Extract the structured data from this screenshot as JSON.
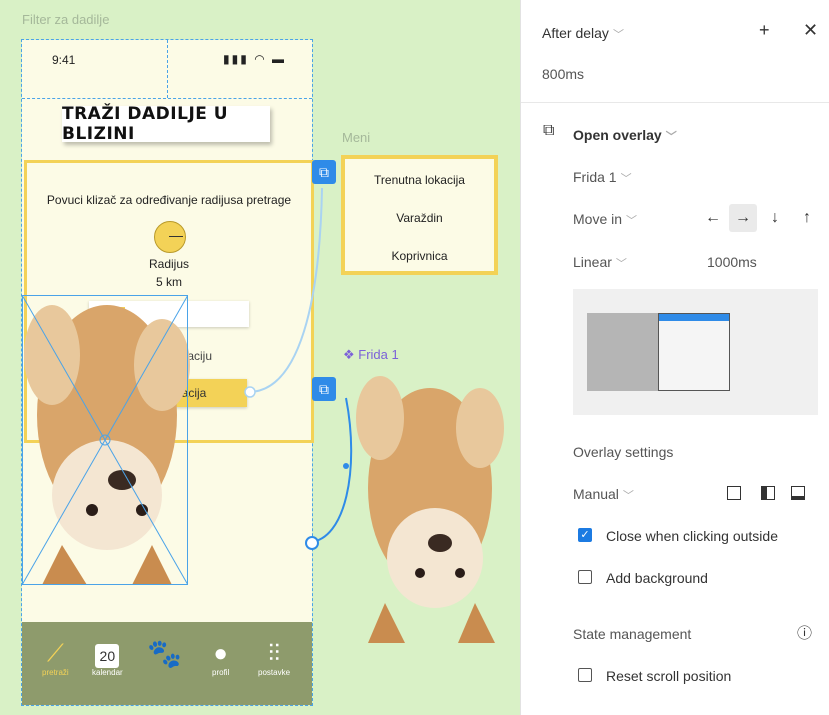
{
  "canvas": {
    "frame_label": "Filter za dadilje",
    "status_time": "9:41",
    "title": "TRAŽI DADILJE U BLIZINI",
    "hint": "Povuci klizač za određivanje radijusa pretrage",
    "radius_label": "Radijus",
    "radius_value": "5 km",
    "choose_location": "Odaberi lokaciju",
    "wanted_location": "Željena lokacija",
    "nav": [
      {
        "label": "pretraži",
        "icon": "search-icon"
      },
      {
        "label": "kalendar",
        "icon": "calendar-icon",
        "day": "20"
      },
      {
        "label": "",
        "icon": "paw-icon"
      },
      {
        "label": "profil",
        "icon": "profile-icon"
      },
      {
        "label": "postavke",
        "icon": "settings-icon"
      }
    ],
    "meni_label": "Meni",
    "menu_items": [
      "Trenutna lokacija",
      "Varaždin",
      "Koprivnica"
    ],
    "frida_label": "❖ Frida 1"
  },
  "panel": {
    "trigger": "After delay",
    "delay": "800ms",
    "action": "Open overlay",
    "destination": "Frida 1",
    "animation": "Move in",
    "easing": "Linear",
    "duration": "1000ms",
    "overlay_settings": "Overlay settings",
    "position": "Manual",
    "close_outside": "Close when clicking outside",
    "close_outside_checked": true,
    "add_background": "Add background",
    "add_background_checked": false,
    "state_management": "State management",
    "reset_scroll": "Reset scroll position",
    "reset_scroll_checked": false,
    "accent": "#1c7be2"
  }
}
